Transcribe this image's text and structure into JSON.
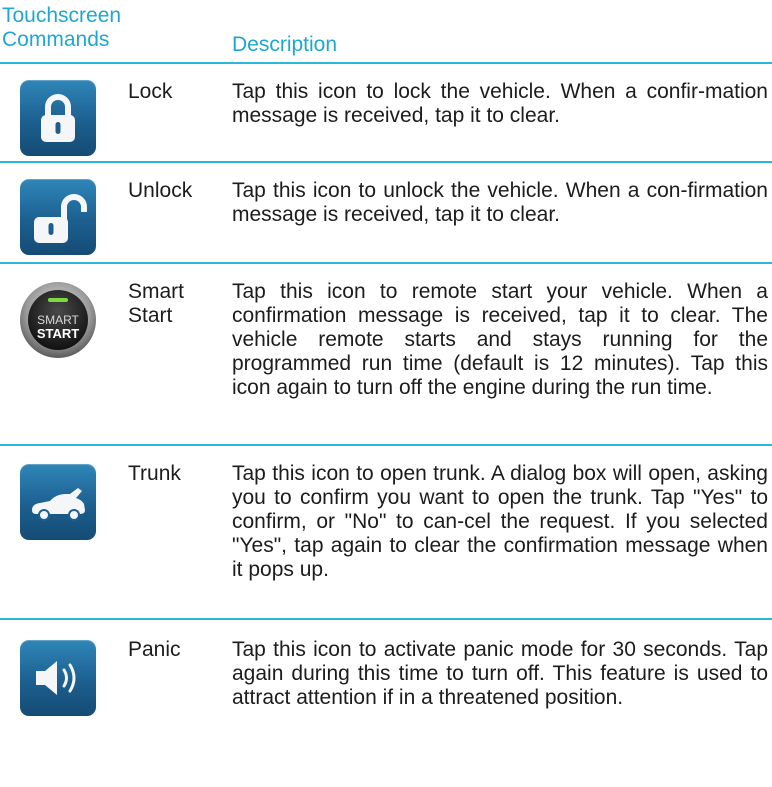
{
  "header": {
    "col_commands": "Touchscreen\nCommands",
    "col_commands_line1": "Touchscreen",
    "col_commands_line2": "Commands",
    "col_description": "Description"
  },
  "rows": [
    {
      "command": "Lock",
      "icon": "lock-closed-icon",
      "description": "Tap this icon to lock the vehicle. When a confir-mation message is received, tap it to clear."
    },
    {
      "command": "Unlock",
      "icon": "lock-open-icon",
      "description": "Tap this icon to unlock the vehicle. When a con-firmation message is received, tap it to clear."
    },
    {
      "command_line1": "Smart",
      "command_line2": "Start",
      "icon": "smart-start-icon",
      "icon_text_top": "SMART",
      "icon_text_bottom": "START",
      "description": "Tap this icon to remote start your vehicle. When a confirmation message is received, tap it to clear. The vehicle remote starts and stays running for the programmed run time (default is 12 minutes). Tap this icon again to turn off the engine during the run time."
    },
    {
      "command": "Trunk",
      "icon": "car-trunk-icon",
      "description": "Tap this icon to open trunk. A dialog box will open, asking you to confirm you want to open the trunk. Tap \"Yes\" to confirm, or \"No\" to can-cel the request. If you selected \"Yes\", tap again to clear the confirmation message when it pops up."
    },
    {
      "command": "Panic",
      "icon": "speaker-icon",
      "description": "Tap this icon to activate panic mode for 30 seconds. Tap again during this time to turn off. This feature is used to attract attention if in a threatened position."
    }
  ],
  "colors": {
    "accent": "#29b8da",
    "header_text": "#1fa8cf",
    "icon_tile": "#1c5f8f"
  }
}
